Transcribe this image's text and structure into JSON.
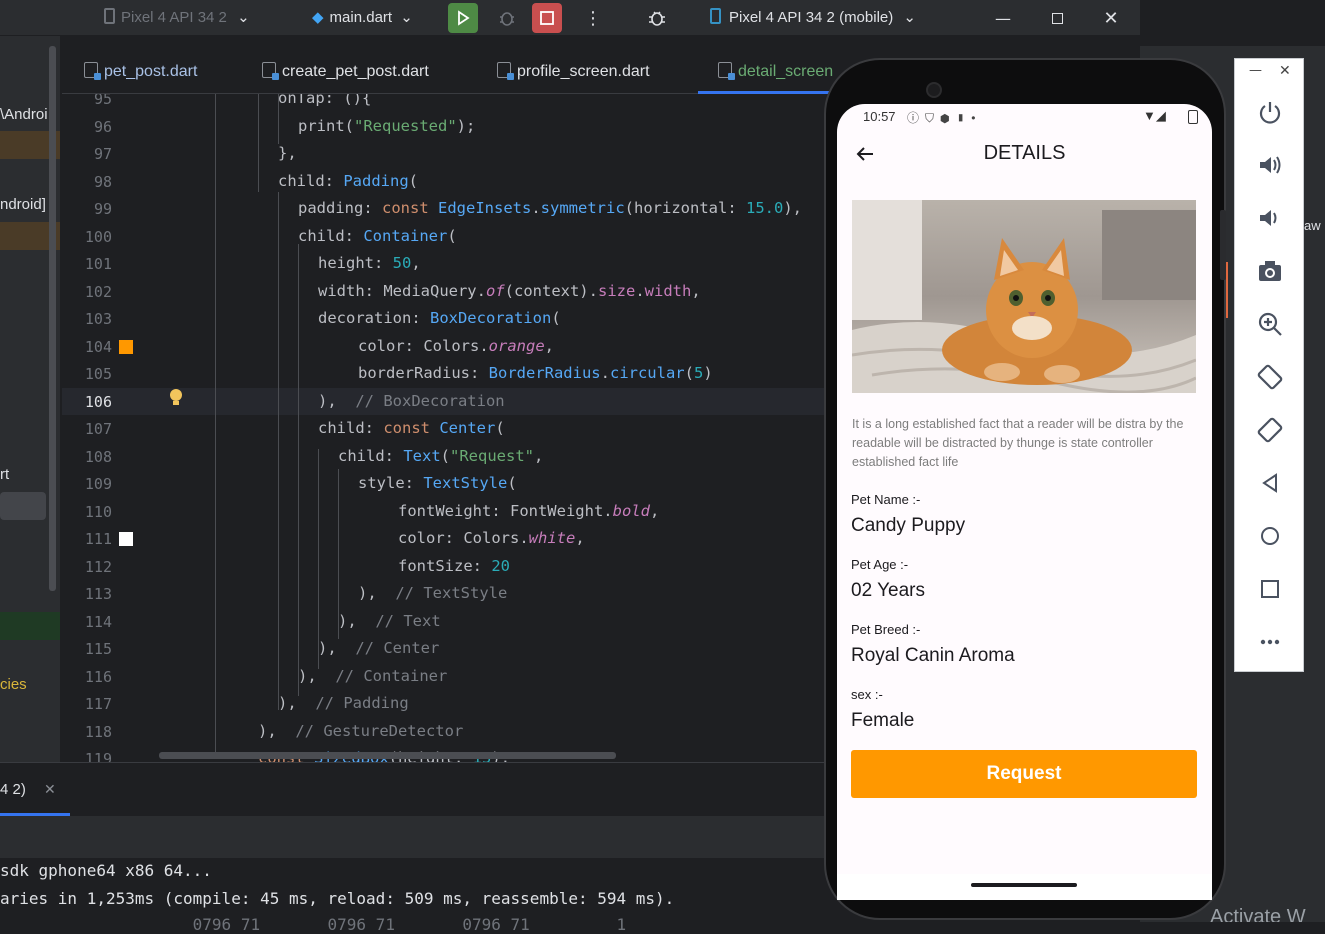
{
  "toolbar": {
    "device_select_dim": "Pixel 4 API 34 2",
    "run_config": "main.dart",
    "device_select": "Pixel 4 API 34 2 (mobile)"
  },
  "left_panel": {
    "fragments": [
      "\\Androi",
      "ndroid]",
      "rt",
      "cies"
    ]
  },
  "tabs": [
    {
      "label": "pet_post.dart"
    },
    {
      "label": "create_pet_post.dart"
    },
    {
      "label": "profile_screen.dart"
    },
    {
      "label": "detail_screen"
    }
  ],
  "editor": {
    "line_numbers": [
      "95",
      "96",
      "97",
      "98",
      "99",
      "100",
      "101",
      "102",
      "103",
      "104",
      "105",
      "106",
      "107",
      "108",
      "109",
      "110",
      "111",
      "112",
      "113",
      "114",
      "115",
      "116",
      "117",
      "118",
      "119"
    ],
    "current_line": "106",
    "gutter_colors": {
      "orange": "#ff9800",
      "white": "#ffffff"
    }
  },
  "bottom": {
    "run_tab": "4 2)",
    "lines": [
      "sdk gphone64 x86 64...",
      "aries in 1,253ms (compile: 45 ms, reload: 509 ms, reassemble: 594 ms).",
      "                    0796 71       0796 71       0796 71         1"
    ]
  },
  "phone": {
    "status_time": "10:57",
    "title": "DETAILS",
    "description": "It is a long established fact that a reader will be distra by the readable  will be distracted by thunge is state controller established fact life",
    "fields": [
      {
        "label": "Pet Name :-",
        "value": "Candy Puppy"
      },
      {
        "label": "Pet Age :-",
        "value": "02 Years"
      },
      {
        "label": "Pet Breed :-",
        "value": "Royal Canin Aroma"
      },
      {
        "label": "sex :-",
        "value": "Female"
      }
    ],
    "request_button": "Request",
    "accent": "#ff9800"
  },
  "emulator_panel": {
    "icons": [
      "power-icon",
      "volume-up-icon",
      "volume-down-icon",
      "camera-icon",
      "zoom-icon",
      "rotate-left-icon",
      "rotate-right-icon",
      "back-icon",
      "home-icon",
      "overview-icon",
      "more-icon"
    ]
  },
  "background_fragments": {
    "right_edge": "aw",
    "watermark": "Activate W"
  }
}
